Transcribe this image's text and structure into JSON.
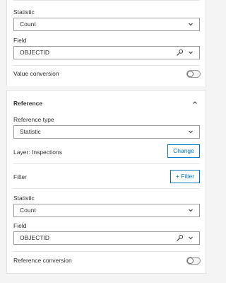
{
  "top": {
    "statistic_label": "Statistic",
    "statistic_value": "Count",
    "field_label": "Field",
    "field_value": "OBJECTID",
    "value_conversion_label": "Value conversion"
  },
  "reference": {
    "title": "Reference",
    "reference_type_label": "Reference type",
    "reference_type_value": "Statistic",
    "layer_label": "Layer: Inspections",
    "change_button": "Change",
    "filter_label": "Filter",
    "filter_button": "+ Filter",
    "statistic_label": "Statistic",
    "statistic_value": "Count",
    "field_label": "Field",
    "field_value": "OBJECTID",
    "reference_conversion_label": "Reference conversion"
  },
  "icons": {
    "chevron_down": "chevron-down-icon",
    "chevron_up": "chevron-up-icon",
    "wrench": "wrench-icon"
  },
  "colors": {
    "accent": "#007ac2",
    "border": "#9d9d9d",
    "background": "#f4f4f4"
  }
}
